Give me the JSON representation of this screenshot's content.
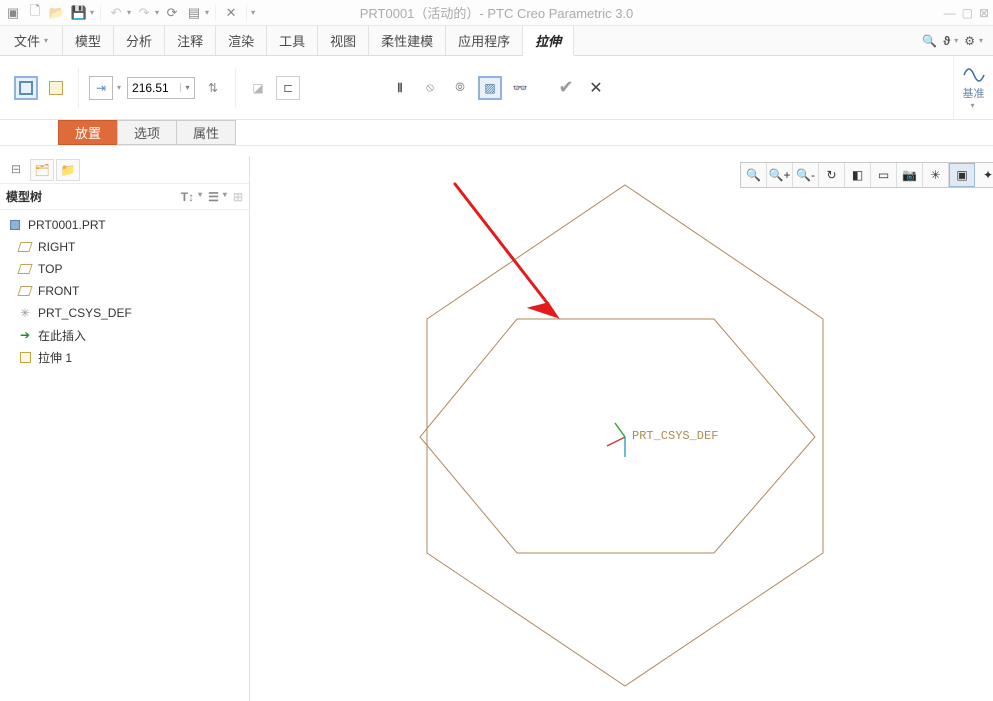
{
  "title": "PRT0001（活动的）- PTC Creo Parametric 3.0",
  "menu": {
    "file": "文件",
    "file_caret": "▾",
    "items": [
      "模型",
      "分析",
      "注释",
      "渲染",
      "工具",
      "视图",
      "柔性建模",
      "应用程序",
      "拉伸"
    ],
    "active_index": 8
  },
  "ribbon": {
    "depth_value": "216.51",
    "right_label": "基准"
  },
  "subtabs": {
    "items": [
      "放置",
      "选项",
      "属性"
    ],
    "active_index": 0
  },
  "sidebar": {
    "header": "模型树",
    "root": "PRT0001.PRT",
    "planes": [
      "RIGHT",
      "TOP",
      "FRONT"
    ],
    "csys": "PRT_CSYS_DEF",
    "insert": "在此插入",
    "extrude": "拉伸 1"
  },
  "viewport": {
    "csys_label": "PRT_CSYS_DEF"
  }
}
